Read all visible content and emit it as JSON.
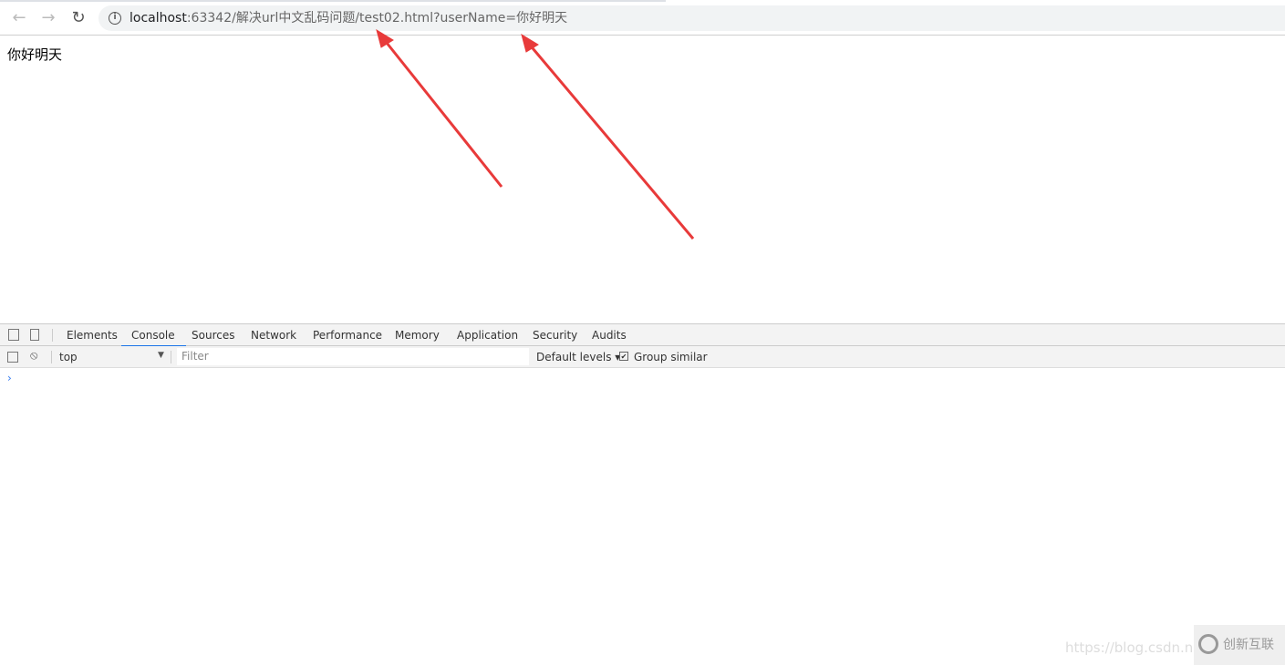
{
  "browser": {
    "url_host": "localhost",
    "url_rest": ":63342/解决url中文乱码问题/test02.html?userName=你好明天"
  },
  "page": {
    "text": "你好明天"
  },
  "devtools": {
    "tabs": [
      "Elements",
      "Console",
      "Sources",
      "Network",
      "Performance",
      "Memory",
      "Application",
      "Security",
      "Audits"
    ],
    "active_tab": "Console",
    "context": "top",
    "filter_placeholder": "Filter",
    "levels": "Default levels ▾",
    "group_similar": "Group similar",
    "group_similar_checked": true,
    "prompt": "›"
  },
  "watermark": {
    "url": "https://blog.csdn.net",
    "logo": "创新互联"
  },
  "annotations": {
    "color": "#e83a3a"
  }
}
